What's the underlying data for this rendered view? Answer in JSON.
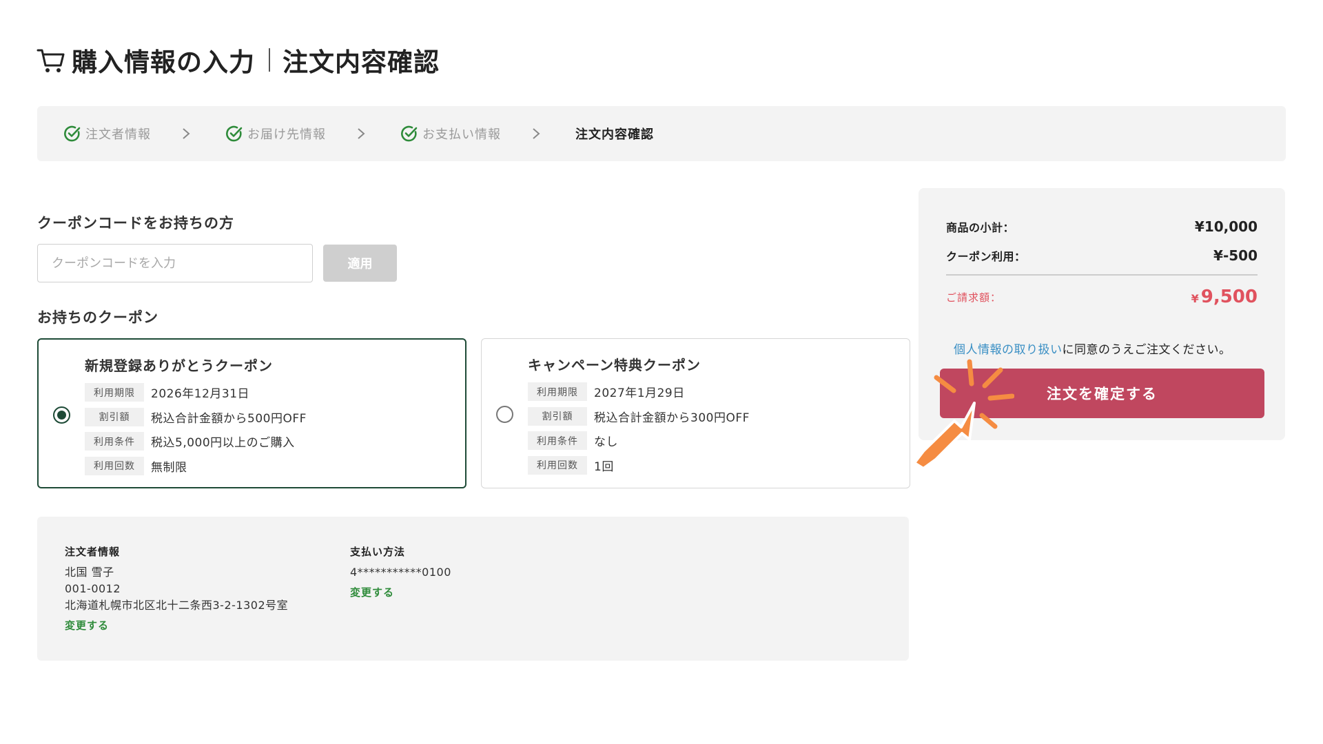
{
  "header": {
    "title_main": "購入情報の入力",
    "title_sub": "注文内容確認",
    "icon": "cart-icon"
  },
  "steps": [
    {
      "label": "注文者情報",
      "done": true
    },
    {
      "label": "お届け先情報",
      "done": true
    },
    {
      "label": "お支払い情報",
      "done": true
    },
    {
      "label": "注文内容確認",
      "done": false,
      "current": true
    }
  ],
  "coupon_code": {
    "heading": "クーポンコードをお持ちの方",
    "placeholder": "クーポンコードを入力",
    "value": "",
    "apply_label": "適用"
  },
  "owned_coupons": {
    "heading": "お持ちのクーポン",
    "items": [
      {
        "name": "新規登録ありがとうクーポン",
        "selected": true,
        "rows": [
          {
            "label": "利用期限",
            "value": "2026年12月31日"
          },
          {
            "label": "割引額",
            "value": "税込合計金額から500円OFF"
          },
          {
            "label": "利用条件",
            "value": "税込5,000円以上のご購入"
          },
          {
            "label": "利用回数",
            "value": "無制限"
          }
        ]
      },
      {
        "name": "キャンペーン特典クーポン",
        "selected": false,
        "rows": [
          {
            "label": "利用期限",
            "value": "2027年1月29日"
          },
          {
            "label": "割引額",
            "value": "税込合計金額から300円OFF"
          },
          {
            "label": "利用条件",
            "value": "なし"
          },
          {
            "label": "利用回数",
            "value": "1回"
          }
        ]
      }
    ]
  },
  "orderer": {
    "heading": "注文者情報",
    "name": "北国 雪子",
    "postal": "001-0012",
    "address": "北海道札幌市北区北十二条西3-2-1302号室",
    "change_label": "変更する"
  },
  "payment": {
    "heading": "支払い方法",
    "card": "4***********0100",
    "change_label": "変更する"
  },
  "summary": {
    "subtotal_label": "商品の小計：",
    "subtotal_value": "¥10,000",
    "coupon_label": "クーポン利用：",
    "coupon_value": "¥-500",
    "total_label": "ご請求額：",
    "total_currency": "¥",
    "total_value": "9,500",
    "agree_link": "個人情報の取り扱い",
    "agree_text": "に同意のうえご注文ください。",
    "confirm_label": "注文を確定する"
  },
  "colors": {
    "check_green": "#2e8b3a",
    "selected_border": "#1d4a36",
    "confirm_button": "#c0475f",
    "total_red": "#e0525e",
    "link_blue": "#3a8fc4",
    "pointer_orange": "#f58c42"
  }
}
